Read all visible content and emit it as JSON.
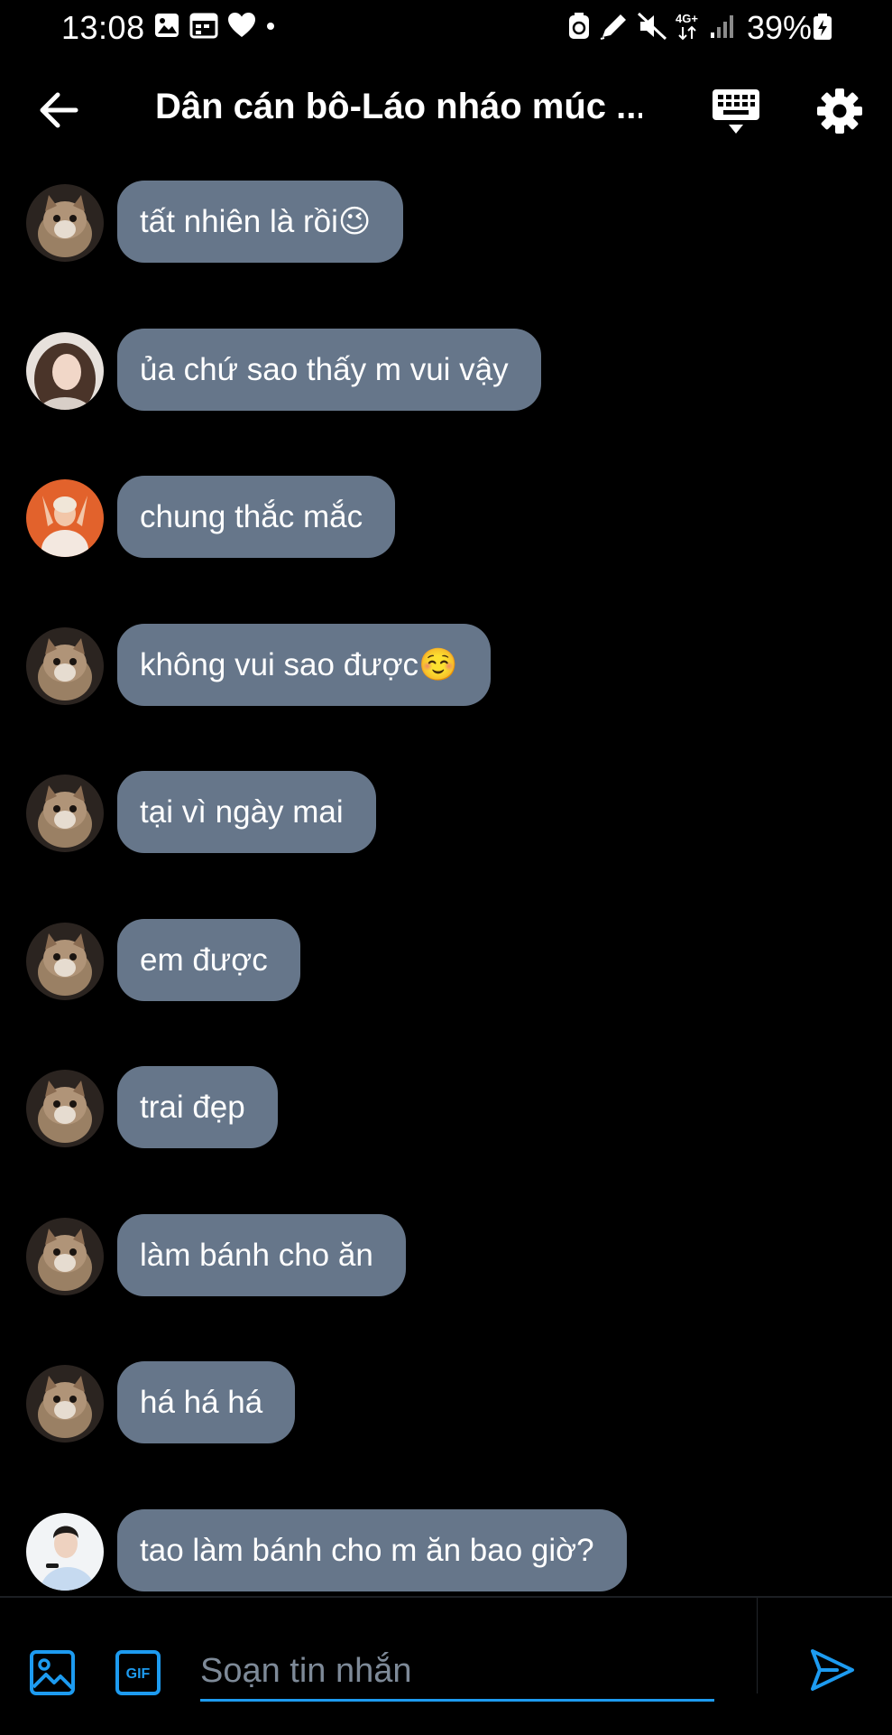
{
  "status_bar": {
    "time": "13:08",
    "battery": "39%",
    "network": "4G+",
    "left_icons": [
      "gallery-icon",
      "calendar-icon",
      "heart-icon",
      "dot-icon"
    ],
    "right_icons": [
      "battery-saver-icon",
      "pen-icon",
      "mute-icon",
      "network-icon",
      "signal-icon"
    ]
  },
  "header": {
    "title": "Dân cán bô-Láo nháo múc ...",
    "back_icon": "arrow-left-icon",
    "keyboard_icon": "keyboard-icon",
    "settings_icon": "gear-icon"
  },
  "messages": [
    {
      "text": "tất nhiên là rồi😉",
      "avatar": "cat-avatar"
    },
    {
      "text": "ủa chứ sao thấy m vui vậy",
      "avatar": "girl-avatar"
    },
    {
      "text": "chung thắc mắc",
      "avatar": "orange-avatar"
    },
    {
      "text": "không vui sao được☺️",
      "avatar": "cat-avatar"
    },
    {
      "text": "tại vì ngày mai",
      "avatar": "cat-avatar"
    },
    {
      "text": "em được",
      "avatar": "cat-avatar"
    },
    {
      "text": "trai đẹp",
      "avatar": "cat-avatar"
    },
    {
      "text": "làm bánh cho ăn",
      "avatar": "cat-avatar"
    },
    {
      "text": "há há há",
      "avatar": "cat-avatar"
    },
    {
      "text": "tao làm bánh cho m ăn bao giờ?",
      "avatar": "boy-avatar"
    }
  ],
  "composer": {
    "placeholder": "Soạn tin nhắn",
    "value": "",
    "gif_label": "GIF",
    "image_icon": "image-icon",
    "send_icon": "send-icon"
  },
  "colors": {
    "background": "#000000",
    "bubble": "#66768a",
    "accent": "#1d9bf0"
  }
}
